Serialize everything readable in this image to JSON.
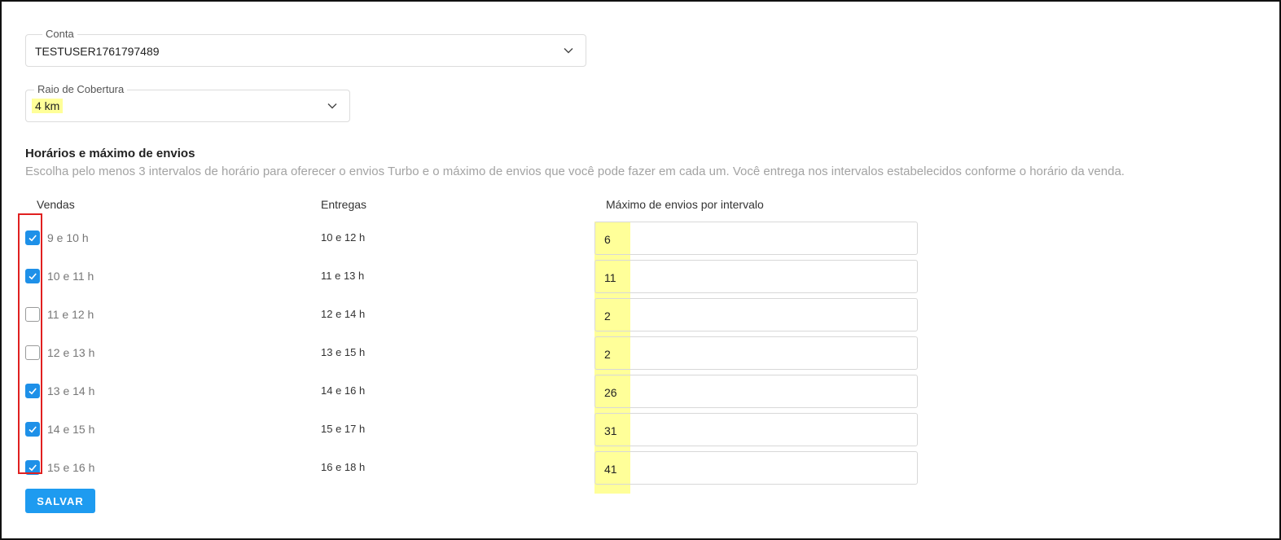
{
  "account": {
    "label": "Conta",
    "value": "TESTUSER1761797489"
  },
  "radius": {
    "label": "Raio de Cobertura",
    "value": "4 km"
  },
  "section": {
    "title": "Horários e máximo de envios",
    "description": "Escolha pelo menos 3 intervalos de horário para oferecer o envios Turbo e o máximo de envios que você pode fazer em cada um. Você entrega nos intervalos estabelecidos conforme o horário da venda."
  },
  "columns": {
    "sales": "Vendas",
    "deliveries": "Entregas",
    "max": "Máximo de envios por intervalo"
  },
  "rows": [
    {
      "sale": "9 e 10 h",
      "delivery": "10 e 12 h",
      "max": "6",
      "checked": true
    },
    {
      "sale": "10 e 11 h",
      "delivery": "11 e 13 h",
      "max": "11",
      "checked": true
    },
    {
      "sale": "11 e 12 h",
      "delivery": "12 e 14 h",
      "max": "2",
      "checked": false
    },
    {
      "sale": "12 e 13 h",
      "delivery": "13 e 15 h",
      "max": "2",
      "checked": false
    },
    {
      "sale": "13 e 14 h",
      "delivery": "14 e 16 h",
      "max": "26",
      "checked": true
    },
    {
      "sale": "14 e 15 h",
      "delivery": "15 e 17 h",
      "max": "31",
      "checked": true
    },
    {
      "sale": "15 e 16 h",
      "delivery": "16 e 18 h",
      "max": "41",
      "checked": true
    }
  ],
  "save_button": "SALVAR",
  "colors": {
    "accent": "#1e9bf0",
    "highlight": "#ffff99",
    "annotation": "#e02020"
  }
}
